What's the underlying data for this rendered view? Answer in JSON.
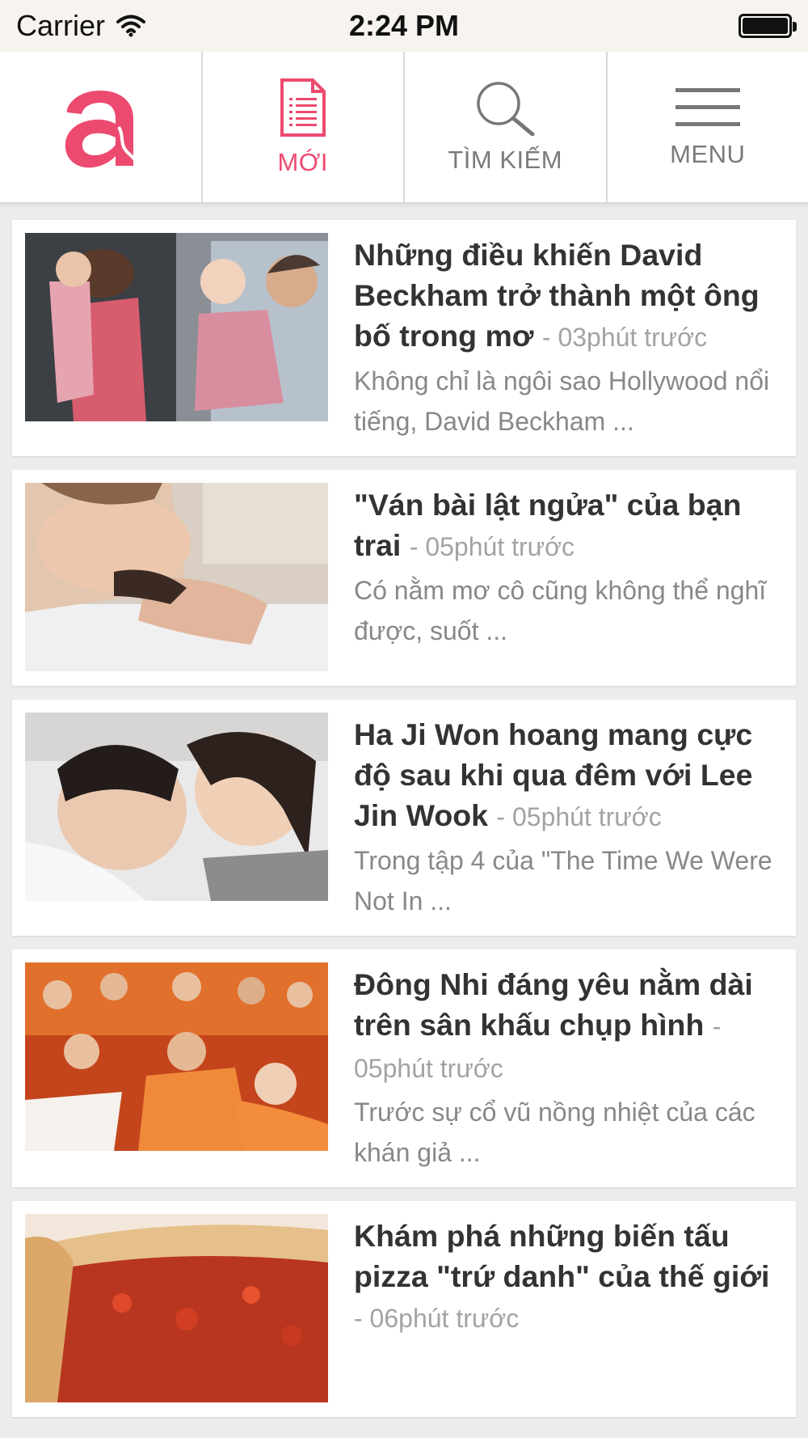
{
  "status_bar": {
    "carrier": "Carrier",
    "time": "2:24 PM"
  },
  "navbar": {
    "logo_icon": "brand-logo-a",
    "tabs": [
      {
        "label": "MỚI",
        "icon": "document-list-icon",
        "active": true
      },
      {
        "label": "TÌM KIẾM",
        "icon": "search-icon",
        "active": false
      },
      {
        "label": "MENU",
        "icon": "hamburger-menu-icon",
        "active": false
      }
    ]
  },
  "colors": {
    "accent": "#ec4a6f",
    "title": "#333333",
    "meta": "#a3a3a3",
    "excerpt": "#888888",
    "background": "#ececec"
  },
  "articles": [
    {
      "title": "Những điều khiến David Beckham trở thành một ông bố trong mơ",
      "time": "- 03phút trước",
      "excerpt": "Không chỉ là ngôi sao Hollywood nổi tiếng, David Beckham ..."
    },
    {
      "title": "\"Ván bài lật ngửa\" của bạn trai",
      "time": "- 05phút trước",
      "excerpt": "Có nằm mơ cô cũng không thể nghĩ được, suốt ..."
    },
    {
      "title": "Ha Ji Won hoang mang cực độ sau khi qua đêm với Lee Jin Wook",
      "time": "- 05phút trước",
      "excerpt": "Trong tập 4 của \"The Time We Were Not In ..."
    },
    {
      "title": "Đông Nhi đáng yêu nằm dài trên sân khấu chụp hình",
      "time": "- 05phút trước",
      "excerpt": "Trước sự cổ vũ nồng nhiệt của các khán giả ..."
    },
    {
      "title": "Khám phá những biến tấu pizza \"trứ danh\" của thế giới",
      "time": "- 06phút trước",
      "excerpt": ""
    }
  ]
}
